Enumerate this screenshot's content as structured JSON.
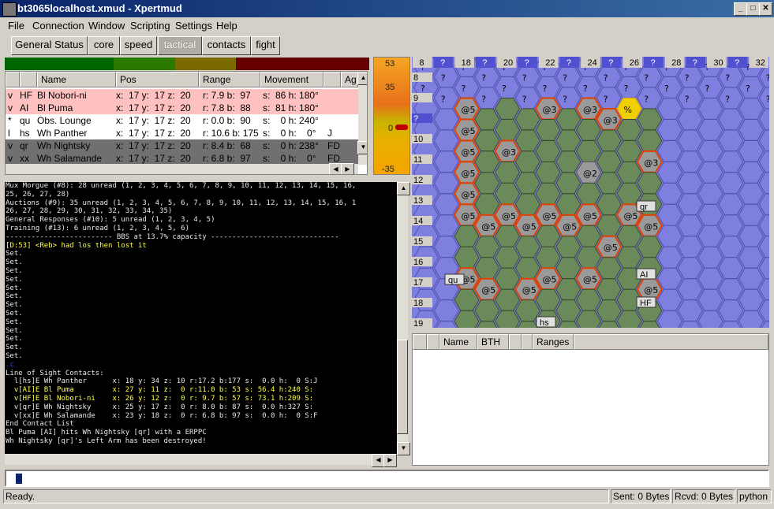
{
  "window": {
    "title": "bt3065localhost.xmud - Xpertmud"
  },
  "menu": [
    "File",
    "Connection",
    "Window",
    "Scripting",
    "Settings",
    "Help"
  ],
  "tabs": [
    {
      "label": "General Status",
      "active": false
    },
    {
      "label": "core",
      "active": false
    },
    {
      "label": "speed",
      "active": false
    },
    {
      "label": "tactical",
      "active": true
    },
    {
      "label": "contacts",
      "active": false
    },
    {
      "label": "fight",
      "active": false
    }
  ],
  "heat_colors": [
    "#006600",
    "#2a7a00",
    "#7a6a00",
    "#660000"
  ],
  "contacts": {
    "headers": [
      "Name",
      "Pos",
      "Range",
      "Movement",
      "Ag"
    ],
    "rows": [
      {
        "flag": "v",
        "id": "HF",
        "name": "Bl Nobori-ni",
        "pos": "x:  17 y:  17 z:  20",
        "range": "r: 7.9 b:  97",
        "move": "s:  86 h: 180°",
        "ext": "",
        "bg": "#ffc0c0"
      },
      {
        "flag": "v",
        "id": "AI",
        "name": "Bl Puma",
        "pos": "x:  17 y:  17 z:  20",
        "range": "r: 7.8 b:  88",
        "move": "s:  81 h: 180°",
        "ext": "",
        "bg": "#ffc0c0"
      },
      {
        "flag": "*",
        "id": "qu",
        "name": "Obs. Lounge",
        "pos": "x:  17 y:  17 z:  20",
        "range": "r: 0.0 b:  90",
        "move": "s:    0 h: 240°",
        "ext": "",
        "bg": "#ffffff"
      },
      {
        "flag": "l",
        "id": "hs",
        "name": "Wh Panther",
        "pos": "x:  17 y:  17 z:  20",
        "range": "r: 10.6 b: 175",
        "move": "s:    0 h:    0°",
        "ext": "J",
        "bg": "#ffffff"
      },
      {
        "flag": "v",
        "id": "qr",
        "name": "Wh Nightsky",
        "pos": "x:  17 y:  17 z:  20",
        "range": "r: 8.4 b:  68",
        "move": "s:    0 h: 238°",
        "ext": "FD",
        "bg": "#707070"
      },
      {
        "flag": "v",
        "id": "xx",
        "name": "Wh Salamande",
        "pos": "x:  17 y:  17 z:  20",
        "range": "r: 6.8 b:  97",
        "move": "s:    0 h:    0°",
        "ext": "FD",
        "bg": "#707070"
      }
    ]
  },
  "gauge": {
    "labels": [
      "53",
      "35",
      "0",
      "-35"
    ],
    "value": 0
  },
  "console": {
    "lines": [
      {
        "t": "Mux Morgue (#8): 28 unread (1, 2, 3, 4, 5, 6, 7, 8, 9, 10, 11, 12, 13, 14, 15, 16,",
        "c": "#e8e8e8"
      },
      {
        "t": "25, 26, 27, 28)",
        "c": "#e8e8e8"
      },
      {
        "t": "Auctions (#9): 35 unread (1, 2, 3, 4, 5, 6, 7, 8, 9, 10, 11, 12, 13, 14, 15, 16, 1",
        "c": "#e8e8e8"
      },
      {
        "t": "26, 27, 28, 29, 30, 31, 32, 33, 34, 35)",
        "c": "#e8e8e8"
      },
      {
        "t": "General Responses (#10): 5 unread (1, 2, 3, 4, 5)",
        "c": "#e8e8e8"
      },
      {
        "t": "Training (#13): 6 unread (1, 2, 3, 4, 5, 6)",
        "c": "#e8e8e8"
      },
      {
        "t": "------------------------- BBS at 13.7% capacity ------------------------------",
        "c": "#e8e8e8"
      },
      {
        "t": "[D:53] <Reb> had los then lost it",
        "c": "#ffff40"
      },
      {
        "t": "Set.",
        "c": "#e8e8e8"
      },
      {
        "t": "Set.",
        "c": "#e8e8e8"
      },
      {
        "t": "Set.",
        "c": "#e8e8e8"
      },
      {
        "t": "Set.",
        "c": "#e8e8e8"
      },
      {
        "t": "Set.",
        "c": "#e8e8e8"
      },
      {
        "t": "Set.",
        "c": "#e8e8e8"
      },
      {
        "t": "Set.",
        "c": "#e8e8e8"
      },
      {
        "t": "Set.",
        "c": "#e8e8e8"
      },
      {
        "t": "Set.",
        "c": "#e8e8e8"
      },
      {
        "t": "Set.",
        "c": "#e8e8e8"
      },
      {
        "t": "Set.",
        "c": "#e8e8e8"
      },
      {
        "t": "Set.",
        "c": "#e8e8e8"
      },
      {
        "t": "Set.",
        "c": "#e8e8e8"
      },
      {
        "t": ".c",
        "c": "#4040ff"
      },
      {
        "t": "Line of Sight Contacts:",
        "c": "#e8e8e8"
      },
      {
        "t": "  l[hs]E Wh Panther      x: 18 y: 34 z: 10 r:17.2 b:177 s:  0.0 h:  0 S:J",
        "c": "#e8e8e8"
      },
      {
        "t": "  v[AI]E Bl Puma         x: 27 y: 11 z:  0 r:11.0 b: 53 s: 56.4 h:240 S:",
        "c": "#ffff40"
      },
      {
        "t": "  v[HF]E Bl Nobori-ni    x: 26 y: 12 z:  0 r: 9.7 b: 57 s: 73.1 h:209 S:",
        "c": "#ffff40"
      },
      {
        "t": "  v[qr]E Wh Nightsky     x: 25 y: 17 z:  0 r: 8.0 b: 87 s:  0.0 h:327 S:",
        "c": "#e8e8e8"
      },
      {
        "t": "  v[xx]E Wh Salamande    x: 23 y: 18 z:  0 r: 6.8 b: 97 s:  0.0 h:  0 S:F",
        "c": "#e8e8e8"
      },
      {
        "t": "End Contact List",
        "c": "#e8e8e8"
      },
      {
        "t": "Bl Puma [AI] hits Wh Nightsky [qr] with a ERPPC",
        "c": "#e8e8e8"
      },
      {
        "t": "Wh Nightsky [qr]'s Left Arm has been destroyed!",
        "c": "#e8e8e8"
      }
    ]
  },
  "map": {
    "col_labels": [
      "8",
      "?",
      "18",
      "?",
      "20",
      "?",
      "22",
      "?",
      "24",
      "?",
      "26",
      "?",
      "28",
      "?",
      "30",
      "?",
      "32"
    ],
    "row_labels": [
      "8",
      "9",
      "?",
      "10",
      "11",
      "12",
      "13",
      "14",
      "15",
      "16",
      "17",
      "18",
      "19"
    ],
    "terrain_colors": {
      "water": "#7f7fe0",
      "plain": "#6b8a5a",
      "building": "#9a9a9a",
      "unknown": "#7f7fe0",
      "fire": "#f0d000"
    },
    "hex_text": {
      "unknown": "?",
      "building": "@5",
      "b3": "@3",
      "b2": "@2",
      "fire": "%"
    },
    "unit_labels": [
      "qr",
      "AI",
      "HF",
      "qu",
      "hs"
    ]
  },
  "weapons": {
    "headers": [
      "Name",
      "BTH",
      "Ranges"
    ]
  },
  "status": {
    "ready": "Ready.",
    "sent": "Sent: 0 Bytes",
    "rcvd": "Rcvd: 0 Bytes",
    "lang": "python"
  }
}
